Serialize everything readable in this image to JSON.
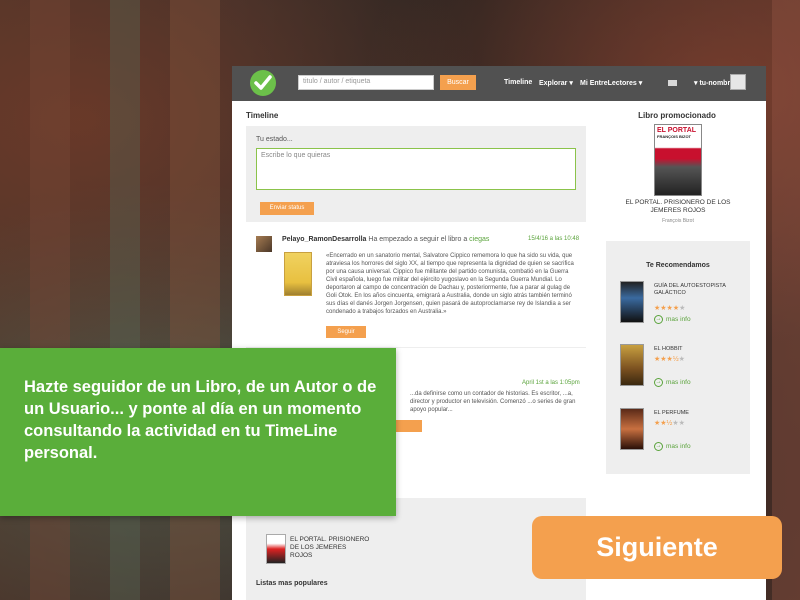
{
  "header": {
    "search_placeholder": "titulo / autor / etiqueta",
    "search_button": "Buscar",
    "nav": [
      "Timeline",
      "Explorar",
      "Mi EntreLectores"
    ],
    "user_name": "tu-nombre"
  },
  "timeline": {
    "title": "Timeline",
    "status_label": "Tu estado...",
    "status_placeholder": "Escribe lo que quieras",
    "send_button": "Enviar status"
  },
  "activity": {
    "user": "Pelayo_RamonDesarrolla",
    "action": " Ha empezado a seguir el libro a ",
    "book": "ciegas",
    "date": "15/4/16 a las 10:48",
    "text": "«Encerrado en un sanatorio mental, Salvatore Cippico rememora lo que ha sido su vida, que atraviesa los horrores del siglo XX, al tiempo que representa la dignidad de quien se sacrifica por una causa universal. Cippico fue militante del partido comunista, combatió en la Guerra Civil española, luego fue militar del ejército yugoslavo en la Segunda Guerra Mundial. Lo deportaron al campo de concentración de Dachau y, posteriormente, fue a parar al gulag de Goli Otok. En los años cincuenta, emigrará a Australia, donde un siglo atrás también terminó sus días el danés Jorgen Jorgensen, quien pasará de autoproclamarse rey de Islandia a ser condenado a trabajos forzados en Australia.»",
    "follow_button": "Seguir"
  },
  "activity2": {
    "date": "April 1st a las 1:05pm",
    "text": "...da definirse como un contador de historias. Es escritor, ...a, director y productor en televisión. Comenzó ...o series de gran apoyo popular..."
  },
  "lower": {
    "book_title": "EL PORTAL. PRISIONERO DE LOS JEMERES ROJOS",
    "lists_title": "Listas mas populares"
  },
  "promo": {
    "title": "Libro promocionado",
    "cover_title": "EL PORTAL",
    "cover_author": "FRANÇOIS BIZOT",
    "name": "EL PORTAL. PRISIONERO DE LOS JEMERES ROJOS",
    "author": "François Bizot"
  },
  "recommend": {
    "title": "Te Recomendamos",
    "more_label": "mas info",
    "items": [
      {
        "name": "GUÍA DEL AUTOESTOPISTA GALÁCTICO",
        "rating": 4
      },
      {
        "name": "EL HOBBIT",
        "rating": 3.5
      },
      {
        "name": "EL PERFUME",
        "rating": 2.5
      }
    ]
  },
  "callout": {
    "text": "Hazte seguidor de un Libro, de un Autor o de un Usuario... y ponte al día en un momento consultando la actividad en tu TimeLine personal."
  },
  "next_button": "Siguiente",
  "colors": {
    "accent_orange": "#f4a04e",
    "accent_green": "#5aae3a",
    "topbar": "#515151"
  }
}
